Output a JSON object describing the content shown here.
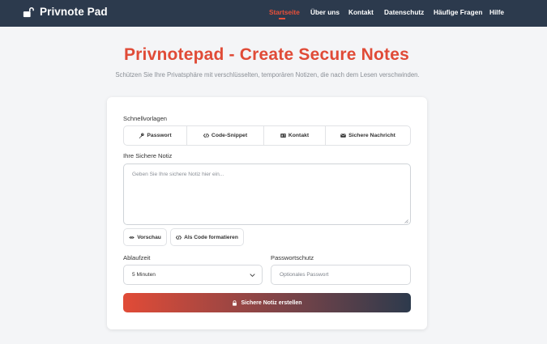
{
  "brand": {
    "name": "Privnote Pad",
    "icon": "lock-open-icon"
  },
  "nav": {
    "items": [
      {
        "label": "Startseite",
        "active": true
      },
      {
        "label": "Über uns",
        "active": false
      },
      {
        "label": "Kontakt",
        "active": false
      },
      {
        "label": "Datenschutz",
        "active": false
      },
      {
        "label": "Häufige Fragen",
        "active": false
      },
      {
        "label": "Hilfe",
        "active": false
      }
    ],
    "active_color": "#e8503a"
  },
  "hero": {
    "title": "Privnotepad - Create Secure Notes",
    "subtitle": "Schützen Sie Ihre Privatsphäre mit verschlüsselten, temporären Notizen, die nach dem Lesen verschwinden."
  },
  "form": {
    "templates_label": "Schnellvorlagen",
    "templates": [
      {
        "label": "Passwort",
        "icon": "key-icon"
      },
      {
        "label": "Code-Snippet",
        "icon": "code-icon"
      },
      {
        "label": "Kontakt",
        "icon": "contact-card-icon"
      },
      {
        "label": "Sichere Nachricht",
        "icon": "envelope-icon"
      }
    ],
    "note_label": "Ihre Sichere Notiz",
    "note_placeholder": "Geben Sie Ihre sichere Notiz hier ein...",
    "note_value": "",
    "preview_label": "Vorschau",
    "format_code_label": "Als Code formatieren",
    "expiry_label": "Ablaufzeit",
    "expiry_selected": "5 Minuten",
    "password_label": "Passwortschutz",
    "password_placeholder": "Optionales Passwort",
    "password_value": "",
    "submit_label": "Sichere Notiz erstellen"
  },
  "colors": {
    "navbar": "#2c3a4d",
    "accent": "#e04b37",
    "background": "#f4f5f7"
  }
}
